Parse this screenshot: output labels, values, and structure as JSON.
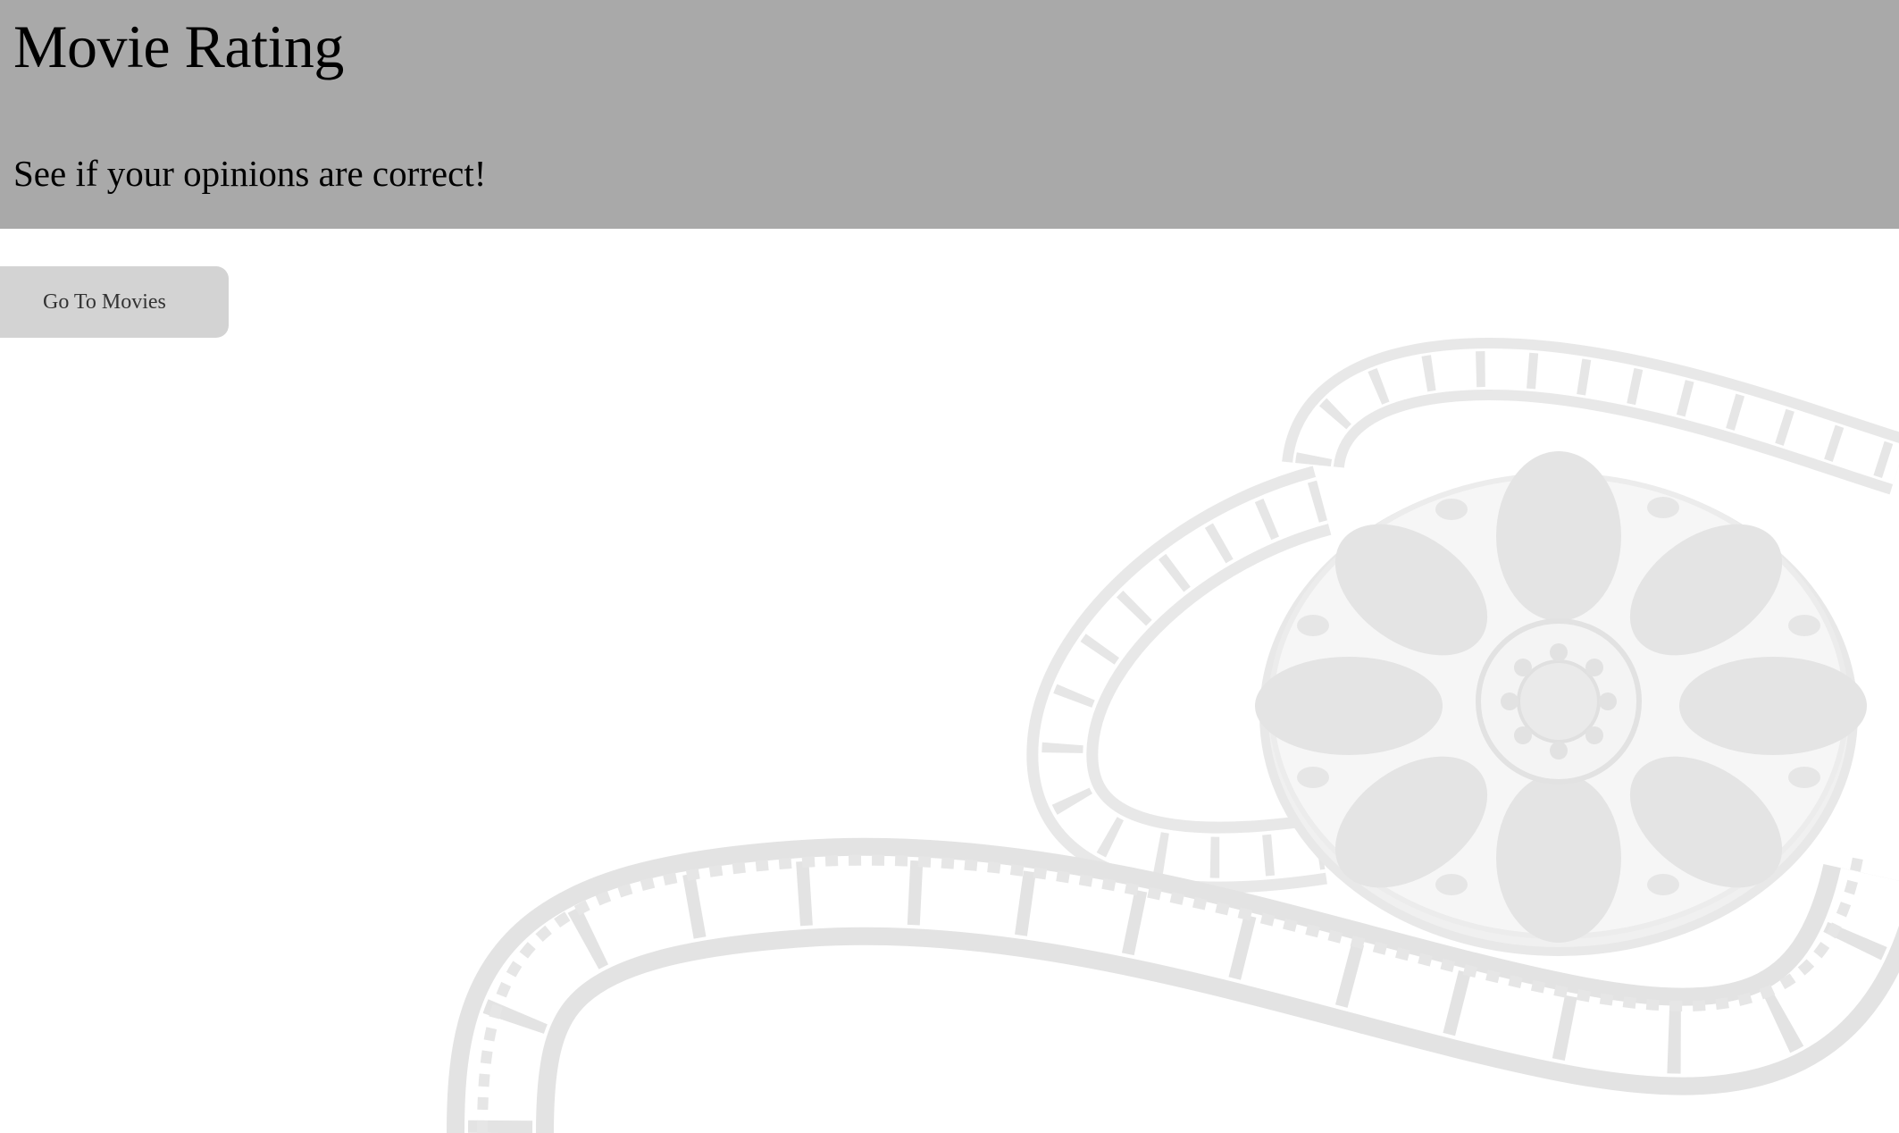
{
  "header": {
    "title": "Movie Rating",
    "subtitle": "See if your opinions are correct!",
    "background_color": "#a9a9a9"
  },
  "actions": {
    "go_to_movies_label": "Go To Movies",
    "button_color": "#d3d3d3"
  },
  "background": {
    "icon": "film-reel-icon",
    "color": "#e2e2e2"
  }
}
